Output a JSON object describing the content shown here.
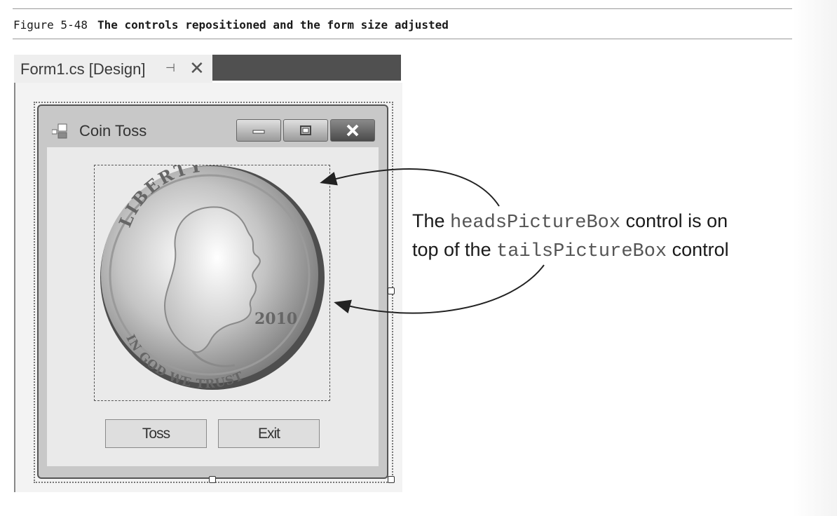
{
  "caption": {
    "figure_number": "Figure 5-48",
    "title": "The controls repositioned and the form size adjusted"
  },
  "designer_tab": {
    "title": "Form1.cs [Design]",
    "pin_icon": "pin-icon",
    "close_icon": "close-icon"
  },
  "form": {
    "title": "Coin Toss",
    "icon": "form-icon",
    "caption_buttons": [
      "minimize",
      "maximize",
      "close"
    ]
  },
  "coin": {
    "top_text": "LIBERTY",
    "year": "2010",
    "motto": "IN GOD WE TRUST"
  },
  "buttons": {
    "toss": "Toss",
    "exit": "Exit"
  },
  "annotation": {
    "line1_a": "The ",
    "line1_code": "headsPictureBox",
    "line1_b": " control is on",
    "line2_a": "top of the ",
    "line2_code": "tailsPictureBox",
    "line2_b": " control"
  }
}
